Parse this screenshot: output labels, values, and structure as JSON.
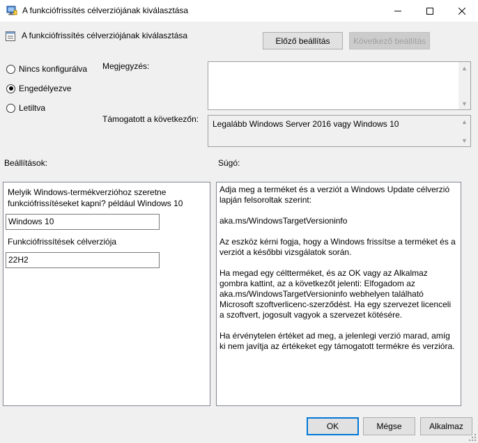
{
  "window": {
    "title": "A funkciófrissítés célverziójának kiválasztása",
    "header_title": "A funkciófrissítés célverziójának kiválasztása"
  },
  "nav": {
    "prev_label": "Előző beállítás",
    "next_label": "Következő beállítás"
  },
  "state": {
    "options": [
      {
        "label": "Nincs konfigurálva",
        "checked": false
      },
      {
        "label": "Engedélyezve",
        "checked": true
      },
      {
        "label": "Letiltva",
        "checked": false
      }
    ]
  },
  "comment": {
    "label": "Megjegyzés:",
    "value": ""
  },
  "supported": {
    "label": "Támogatott a következőn:",
    "value": "Legalább Windows Server 2016 vagy Windows 10"
  },
  "options_section": {
    "label": "Beállítások:",
    "product_prompt": "Melyik Windows-termékverzióhoz szeretne funkciófrissítéseket kapni? például Windows 10",
    "product_value": "Windows 10",
    "target_label": "Funkciófrissítések célverziója",
    "target_value": "22H2"
  },
  "help": {
    "label": "Súgó:",
    "paragraphs": [
      "Adja meg a terméket és a verziót a Windows Update célverzió lapján felsoroltak szerint:",
      "aka.ms/WindowsTargetVersioninfo",
      "Az eszköz kérni fogja, hogy a Windows frissítse a terméket és a verziót a későbbi vizsgálatok során.",
      "Ha megad egy céltterméket, és az OK vagy az Alkalmaz gombra kattint, az a következőt jelenti: Elfogadom az aka.ms/WindowsTargetVersioninfo webhelyen található Microsoft szoftverlicenc-szerződést. Ha egy szervezet licenceli a szoftvert, jogosult vagyok a szervezet kötésére.",
      "Ha érvénytelen értéket ad meg, a jelenlegi verzió marad, amíg ki nem javítja az értékeket egy támogatott termékre és verzióra."
    ]
  },
  "footer": {
    "ok_label": "OK",
    "cancel_label": "Mégse",
    "apply_label": "Alkalmaz"
  },
  "colors": {
    "accent": "#0078d7"
  }
}
